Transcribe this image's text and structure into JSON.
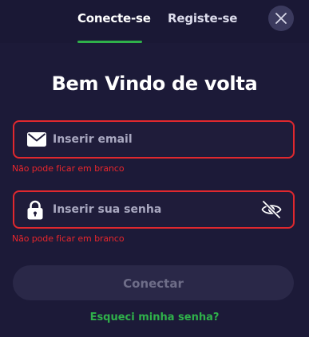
{
  "tabs": {
    "login_label": "Conecte-se",
    "register_label": "Registe-se",
    "active": "login"
  },
  "title": "Bem Vindo de volta",
  "email": {
    "placeholder": "Inserir email",
    "value": "",
    "error": "Não pode ficar em branco",
    "icon": "envelope-icon"
  },
  "password": {
    "placeholder": "Inserir sua senha",
    "value": "",
    "error": "Não pode ficar em branco",
    "icon": "lock-icon",
    "toggle_icon": "eye-off-icon"
  },
  "submit_label": "Conectar",
  "forgot_label": "Esqueci minha senha?",
  "colors": {
    "background": "#1c1a38",
    "accent": "#2fb14a",
    "error": "#e0282e",
    "button_disabled": "#2a2848"
  }
}
